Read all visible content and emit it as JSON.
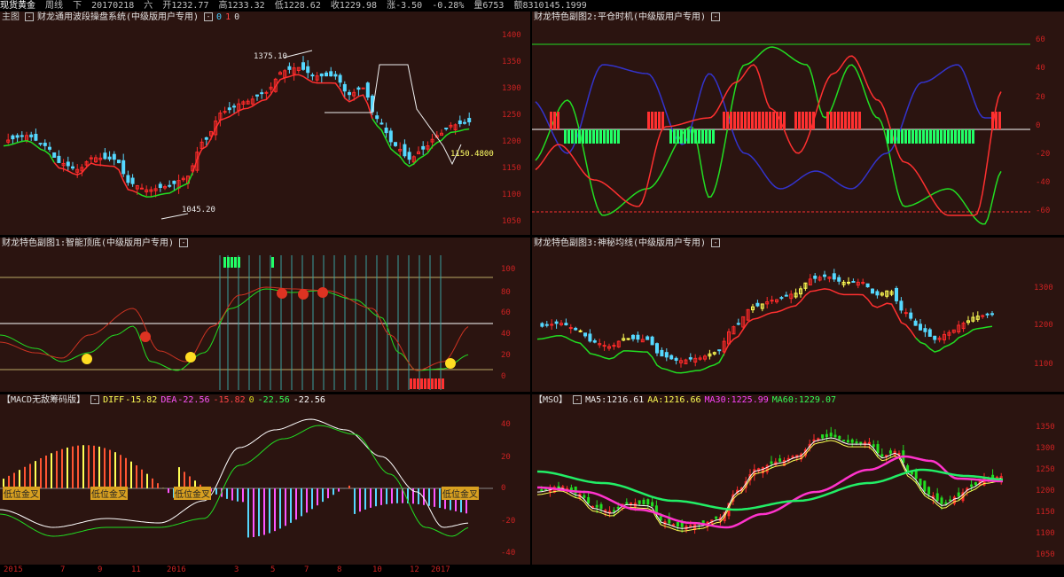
{
  "topbar": {
    "items": [
      "现货黄金",
      "周线",
      "下",
      "20170218",
      "六",
      "开1232.77",
      "高1233.32",
      "低1228.62",
      "收1229.98",
      "涨-3.50",
      "-0.28%",
      "量6753",
      "额8310145.1999"
    ]
  },
  "p1": {
    "label": "主图",
    "name": "财龙通用波段操盘系统(中级版用户专用)",
    "v1": "0",
    "v2": "1",
    "v3": "0",
    "price_high": "1375.10",
    "price_low": "1045.20",
    "price_last": "1150.4800",
    "ticks": [
      "1400",
      "1350",
      "1300",
      "1250",
      "1200",
      "1150",
      "1100",
      "1050"
    ]
  },
  "p2": {
    "name": "财龙特色副图2:平仓时机(中级版用户专用)",
    "ticks": [
      "60",
      "40",
      "20",
      "0",
      "-20",
      "-40",
      "-60"
    ]
  },
  "p3": {
    "name": "财龙特色副图1:智能顶底(中级版用户专用)",
    "ticks": [
      "100",
      "80",
      "60",
      "40",
      "20",
      "0"
    ]
  },
  "p4": {
    "name": "财龙特色副图3:神秘均线(中级版用户专用)",
    "ticks": [
      "1300",
      "1200",
      "1100"
    ]
  },
  "p5": {
    "name": "【MACD无敌筹码版】",
    "diff_label": "DIFF",
    "diff": "-15.82",
    "dea_label": "DEA",
    "dea": "-22.56",
    "x1": "-15.82",
    "x2": "0",
    "x3": "-22.56",
    "x4": "-22.56",
    "zone": [
      "低位金叉",
      "低位金叉",
      "低位金叉",
      "低位金叉"
    ],
    "ticks": [
      "40",
      "20",
      "0",
      "-20",
      "-40"
    ]
  },
  "p6": {
    "name": "【MSO】",
    "ma5": "MA5:1216.61",
    "aa": "AA:1216.66",
    "ma30": "MA30:1225.99",
    "ma60": "MA60:1229.07",
    "ticks": [
      "1350",
      "1300",
      "1250",
      "1200",
      "1150",
      "1100",
      "1050"
    ]
  },
  "dateaxis": {
    "labels": [
      "2015",
      "7",
      "9",
      "11",
      "2016",
      "3",
      "5",
      "7",
      "8",
      "10",
      "12",
      "2017"
    ]
  },
  "colors": {
    "panel": "#2b1410",
    "up": "#ff2a2a",
    "down": "#55d8ff",
    "green": "#22dd22",
    "axis": "#cc2222"
  }
}
